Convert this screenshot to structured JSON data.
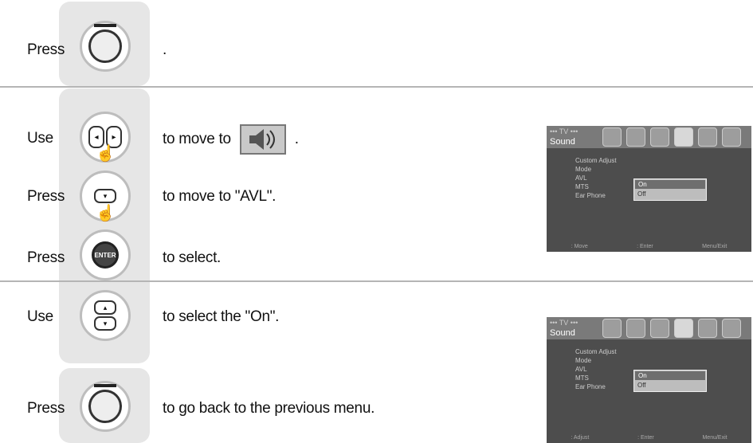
{
  "steps": [
    {
      "label": "Press",
      "text": "."
    },
    {
      "label": "Use",
      "text_before": "to move to",
      "text_after": "."
    },
    {
      "label": "Press",
      "text": "to move to  \"AVL\"."
    },
    {
      "label": "Press",
      "text": "to select."
    },
    {
      "label": "Use",
      "text": "to select the \"On\"."
    },
    {
      "label": "Press",
      "text": "to go back to the previous menu."
    }
  ],
  "keys": {
    "enter": "ENTER"
  },
  "screens": [
    {
      "tv_label": "••• TV •••",
      "title": "Sound",
      "items": [
        "Custom Adjust",
        "Mode",
        "AVL",
        "MTS",
        "Ear Phone"
      ],
      "options": [
        "On",
        "Off"
      ],
      "footer": [
        ":  Move",
        ":  Enter",
        "Menu/Exit"
      ]
    },
    {
      "tv_label": "••• TV •••",
      "title": "Sound",
      "items": [
        "Custom Adjust",
        "Mode",
        "AVL",
        "MTS",
        "Ear Phone"
      ],
      "options": [
        "On",
        "Off"
      ],
      "footer": [
        ":  Adjust",
        ":  Enter",
        "Menu/Exit"
      ]
    }
  ]
}
